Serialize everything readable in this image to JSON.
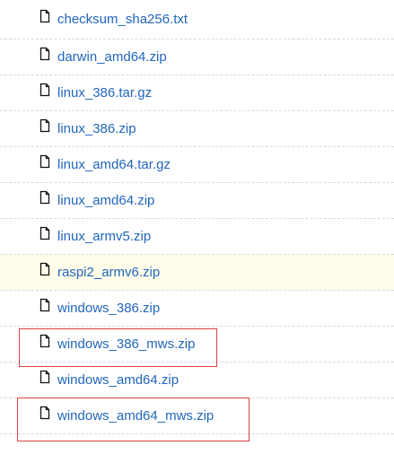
{
  "files": [
    {
      "name": "checksum_sha256.txt",
      "icon": "file-icon"
    },
    {
      "name": "darwin_amd64.zip",
      "icon": "file-icon"
    },
    {
      "name": "linux_386.tar.gz",
      "icon": "file-icon"
    },
    {
      "name": "linux_386.zip",
      "icon": "file-icon"
    },
    {
      "name": "linux_amd64.tar.gz",
      "icon": "file-icon"
    },
    {
      "name": "linux_amd64.zip",
      "icon": "file-icon"
    },
    {
      "name": "linux_armv5.zip",
      "icon": "file-icon"
    },
    {
      "name": "raspi2_armv6.zip",
      "icon": "file-icon"
    },
    {
      "name": "windows_386.zip",
      "icon": "file-icon"
    },
    {
      "name": "windows_386_mws.zip",
      "icon": "file-icon"
    },
    {
      "name": "windows_amd64.zip",
      "icon": "file-icon"
    },
    {
      "name": "windows_amd64_mws.zip",
      "icon": "file-icon"
    }
  ],
  "colors": {
    "link": "#2266bb",
    "row_highlight": "#fffdea",
    "selection_box": "#e04040",
    "row_divider": "#d9d9d9"
  }
}
